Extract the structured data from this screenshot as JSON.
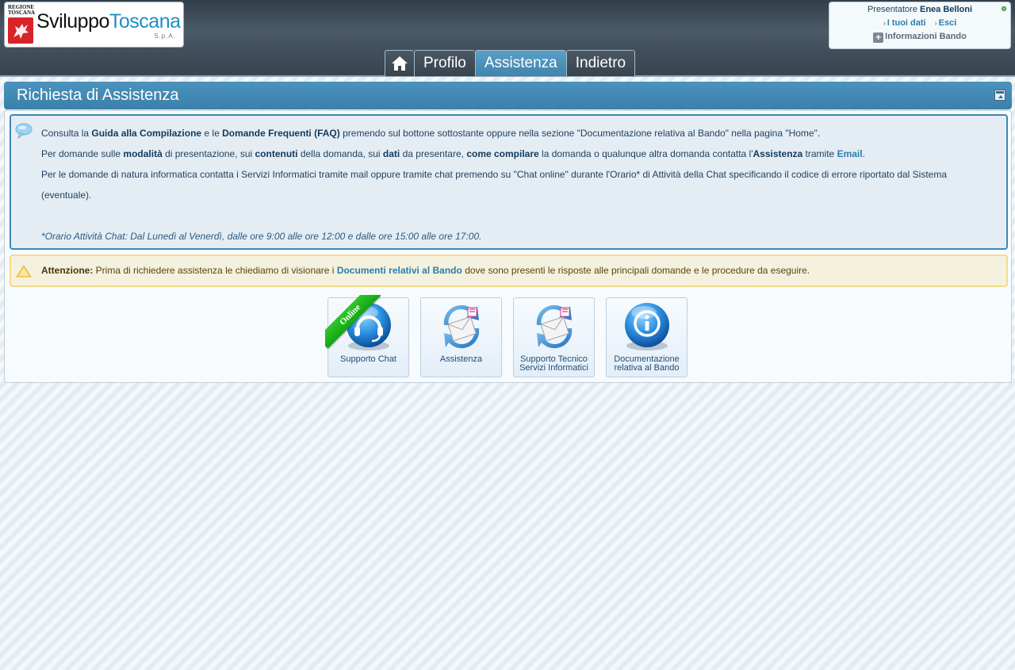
{
  "header": {
    "logo": {
      "region_line1": "REGIONE",
      "region_line2": "TOSCANA",
      "brand_part1": "Sviluppo",
      "brand_part2": "Toscana",
      "suffix": "S.p.A."
    },
    "user": {
      "presenter_label": "Presentatore",
      "presenter_name": "Enea Belloni",
      "link_my_data": "I tuoi dati",
      "link_logout": "Esci",
      "info_label": "Informazioni Bando"
    },
    "nav": {
      "home_icon": "home-icon",
      "tabs": [
        "Profilo",
        "Assistenza",
        "Indietro"
      ],
      "active_tab": "Assistenza"
    }
  },
  "panel": {
    "title": "Richiesta di Assistenza",
    "info": {
      "line1": {
        "t1": "Consulta la ",
        "b1": "Guida alla Compilazione",
        "t2": " e le ",
        "b2": "Domande Frequenti (FAQ)",
        "t3": " premendo sul bottone sottostante oppure nella sezione \"Documentazione relativa al Bando\" nella pagina \"Home\"."
      },
      "line2": {
        "t1": "Per domande sulle ",
        "b1": "modalità",
        "t2": " di presentazione, sui ",
        "b2": "contenuti",
        "t3": " della domanda, sui ",
        "b3": "dati",
        "t4": " da presentare, ",
        "b4": "come compilare",
        "t5": " la domanda o qualunque altra domanda contatta l'",
        "b5": "Assistenza",
        "t6": " tramite ",
        "link": "Email",
        "t7": "."
      },
      "line3": "Per le domande di natura informatica contatta i Servizi Informatici tramite mail oppure tramite chat premendo su \"Chat online\" durante l'Orario* di Attività della Chat specificando il codice di errore riportato dal Sistema (eventuale).",
      "note": "*Orario Attività Chat: Dal Lunedì al Venerdì, dalle ore 9:00 alle ore 12:00 e dalle ore 15:00 alle ore 17:00."
    },
    "warning": {
      "label": "Attenzione:",
      "t1": " Prima di richiedere assistenza le chiediamo di visionare i ",
      "link": "Documenti relativi al Bando",
      "t2": " dove sono presenti le risposte alle principali domande e le procedure da eseguire."
    },
    "tiles": [
      {
        "label1": "Supporto Chat",
        "label2": "",
        "icon": "headset-icon",
        "badge": "Online"
      },
      {
        "label1": "Assistenza",
        "label2": "",
        "icon": "mail-refresh-icon"
      },
      {
        "label1": "Supporto Tecnico",
        "label2": "Servizi Informatici",
        "icon": "mail-refresh-icon"
      },
      {
        "label1": "Documentazione",
        "label2": "relativa al Bando",
        "icon": "info-icon"
      }
    ]
  },
  "colors": {
    "accent": "#3f84ad",
    "link": "#2a7fad",
    "online_badge": "#1eb01e"
  }
}
